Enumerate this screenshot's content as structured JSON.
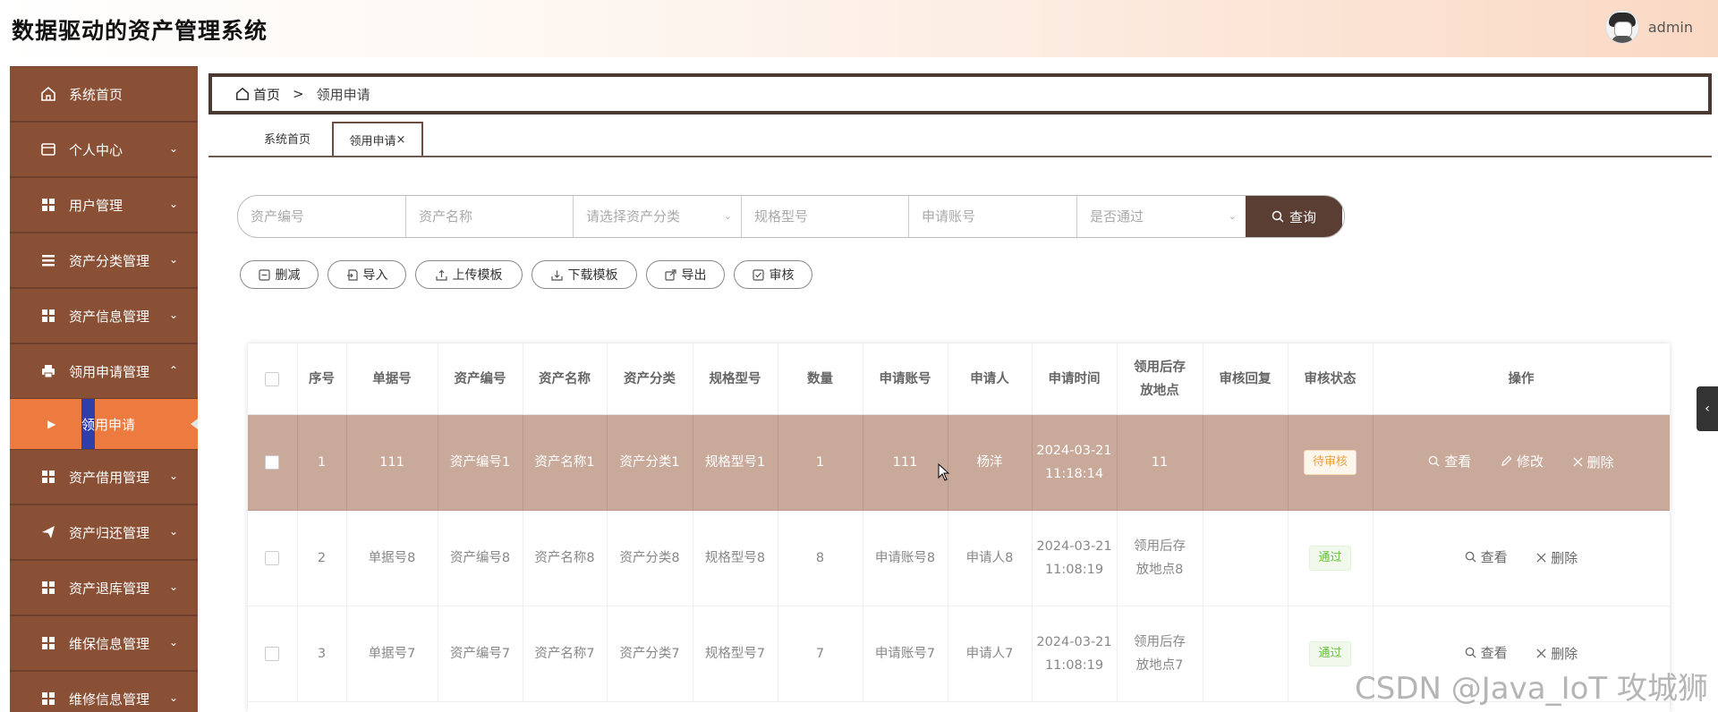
{
  "app": {
    "title": "数据驱动的资产管理系统",
    "username": "admin"
  },
  "sidebar": {
    "items": [
      {
        "label": "系统首页",
        "icon": "home-icon"
      },
      {
        "label": "个人中心",
        "icon": "card-icon"
      },
      {
        "label": "用户管理",
        "icon": "grid-icon"
      },
      {
        "label": "资产分类管理",
        "icon": "list-icon"
      },
      {
        "label": "资产信息管理",
        "icon": "grid-icon"
      },
      {
        "label": "领用申请管理",
        "icon": "printer-icon"
      },
      {
        "label": "资产借用管理",
        "icon": "grid-icon"
      },
      {
        "label": "资产归还管理",
        "icon": "send-icon"
      },
      {
        "label": "资产退库管理",
        "icon": "grid-icon"
      },
      {
        "label": "维保信息管理",
        "icon": "grid-icon"
      },
      {
        "label": "维修信息管理",
        "icon": "grid-icon"
      }
    ],
    "active_sub": "领用申请"
  },
  "breadcrumb": {
    "home": "首页",
    "separator": ">",
    "current": "领用申请"
  },
  "tabs": [
    {
      "label": "系统首页"
    },
    {
      "label": "领用申请",
      "close": "×"
    }
  ],
  "search": {
    "fields": [
      {
        "placeholder": "资产编号"
      },
      {
        "placeholder": "资产名称"
      },
      {
        "placeholder": "请选择资产分类"
      },
      {
        "placeholder": "规格型号"
      },
      {
        "placeholder": "申请账号"
      },
      {
        "placeholder": "是否通过"
      }
    ],
    "button": "查询"
  },
  "actions": [
    "删减",
    "导入",
    "上传模板",
    "下载模板",
    "导出",
    "审核"
  ],
  "table": {
    "headers": [
      "序号",
      "单据号",
      "资产编号",
      "资产名称",
      "资产分类",
      "规格型号",
      "数量",
      "申请账号",
      "申请人",
      "申请时间",
      "领用后存放地点",
      "审核回复",
      "审核状态",
      "操作"
    ],
    "rows": [
      {
        "index": "1",
        "doc_no": "111",
        "asset_no": "资产编号1",
        "asset_name": "资产名称1",
        "category": "资产分类1",
        "spec": "规格型号1",
        "qty": "1",
        "account": "111",
        "applicant": "杨洋",
        "time": "2024-03-21 11:18:14",
        "location": "11",
        "reply": "",
        "status": "待审核",
        "ops": [
          "查看",
          "修改",
          "删除"
        ]
      },
      {
        "index": "2",
        "doc_no": "单据号8",
        "asset_no": "资产编号8",
        "asset_name": "资产名称8",
        "category": "资产分类8",
        "spec": "规格型号8",
        "qty": "8",
        "account": "申请账号8",
        "applicant": "申请人8",
        "time": "2024-03-21 11:08:19",
        "location": "领用后存放地点8",
        "reply": "",
        "status": "通过",
        "ops": [
          "查看",
          "删除"
        ]
      },
      {
        "index": "3",
        "doc_no": "单据号7",
        "asset_no": "资产编号7",
        "asset_name": "资产名称7",
        "category": "资产分类7",
        "spec": "规格型号7",
        "qty": "7",
        "account": "申请账号7",
        "applicant": "申请人7",
        "time": "2024-03-21 11:08:19",
        "location": "领用后存放地点7",
        "reply": "",
        "status": "通过",
        "ops": [
          "查看",
          "删除"
        ]
      }
    ]
  },
  "watermark": "CSDN @Java_IoT 攻城狮",
  "colors": {
    "sidebar_bg": "#8a5036",
    "sidebar_active": "#ed7b3f",
    "accent": "#5a3e33",
    "selected_row": "#c8a99a"
  }
}
